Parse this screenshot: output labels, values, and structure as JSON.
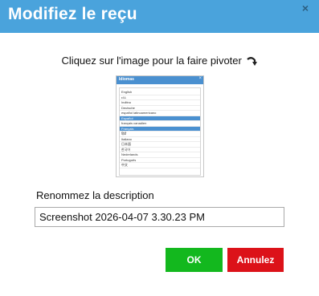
{
  "dialog": {
    "title": "Modifiez le reçu",
    "close_label": "×"
  },
  "instruction": "Cliquez sur l'image pour la faire pivoter",
  "thumbnail": {
    "title": "Idiomas",
    "close_label": "×",
    "languages": [
      {
        "label": "English",
        "selected": false
      },
      {
        "label": "ελλ",
        "selected": false
      },
      {
        "label": "Inditnu",
        "selected": false
      },
      {
        "label": "Deutsche",
        "selected": false
      },
      {
        "label": "español latinoamericano",
        "selected": false
      },
      {
        "label": "Español",
        "selected": true
      },
      {
        "label": "français canadien",
        "selected": false
      },
      {
        "label": "Français",
        "selected": true
      },
      {
        "label": "हिंदी",
        "selected": false
      },
      {
        "label": "Italiano",
        "selected": false
      },
      {
        "label": "日本語",
        "selected": false
      },
      {
        "label": "한국어",
        "selected": false
      },
      {
        "label": "Nederlands",
        "selected": false
      },
      {
        "label": "Português",
        "selected": false
      },
      {
        "label": "中文",
        "selected": false
      }
    ]
  },
  "description": {
    "label": "Renommez la description",
    "value": "Screenshot 2026-04-07 3.30.23 PM"
  },
  "buttons": {
    "ok": "OK",
    "cancel": "Annulez"
  },
  "colors": {
    "header": "#4aa3dc",
    "ok": "#13b81e",
    "cancel": "#dc1219"
  },
  "icons": {
    "rotate": "rotate-arrow-icon",
    "close": "close-icon"
  }
}
